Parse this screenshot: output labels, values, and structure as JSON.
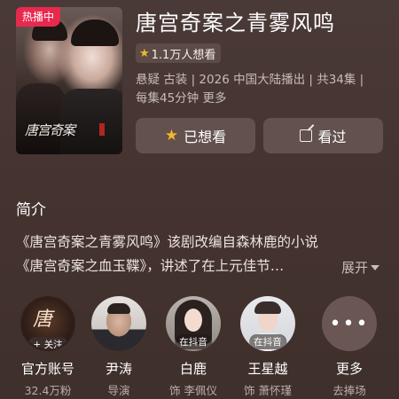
{
  "header": {
    "hot_badge": "热播中",
    "title": "唐宫奇案之青雾风鸣",
    "want_count": "1.1万人想看",
    "meta_line1": "悬疑 古装 | 2026 中国大陆播出 | 共34集 |",
    "meta_line2": "每集45分钟 更多",
    "poster_calligraphy": "唐宫奇案"
  },
  "actions": {
    "want_label": "已想看",
    "seen_label": "看过"
  },
  "intro": {
    "title": "简介",
    "line1": "《唐宫奇案之青雾风鸣》该剧改编自森林鹿的小说",
    "line2": "《唐宫奇案之血玉鞢》，讲述了在上元佳节…",
    "expand_label": "展开"
  },
  "people": [
    {
      "name": "官方账号",
      "role": "32.4万粉",
      "tag": "+ 关注"
    },
    {
      "name": "尹涛",
      "role": "导演"
    },
    {
      "name": "白鹿",
      "role": "饰 李佩仪",
      "tag": "在抖音"
    },
    {
      "name": "王星越",
      "role": "饰 萧怀瑾",
      "tag": "在抖音"
    },
    {
      "name": "更多",
      "role": "去捧场"
    }
  ],
  "icons": {
    "want_star": "star-icon",
    "seen": "edit-icon",
    "more": "ellipsis-icon"
  },
  "colors": {
    "hot_badge": "#e8294e",
    "star": "#f5b72a",
    "background": "#45332f"
  }
}
